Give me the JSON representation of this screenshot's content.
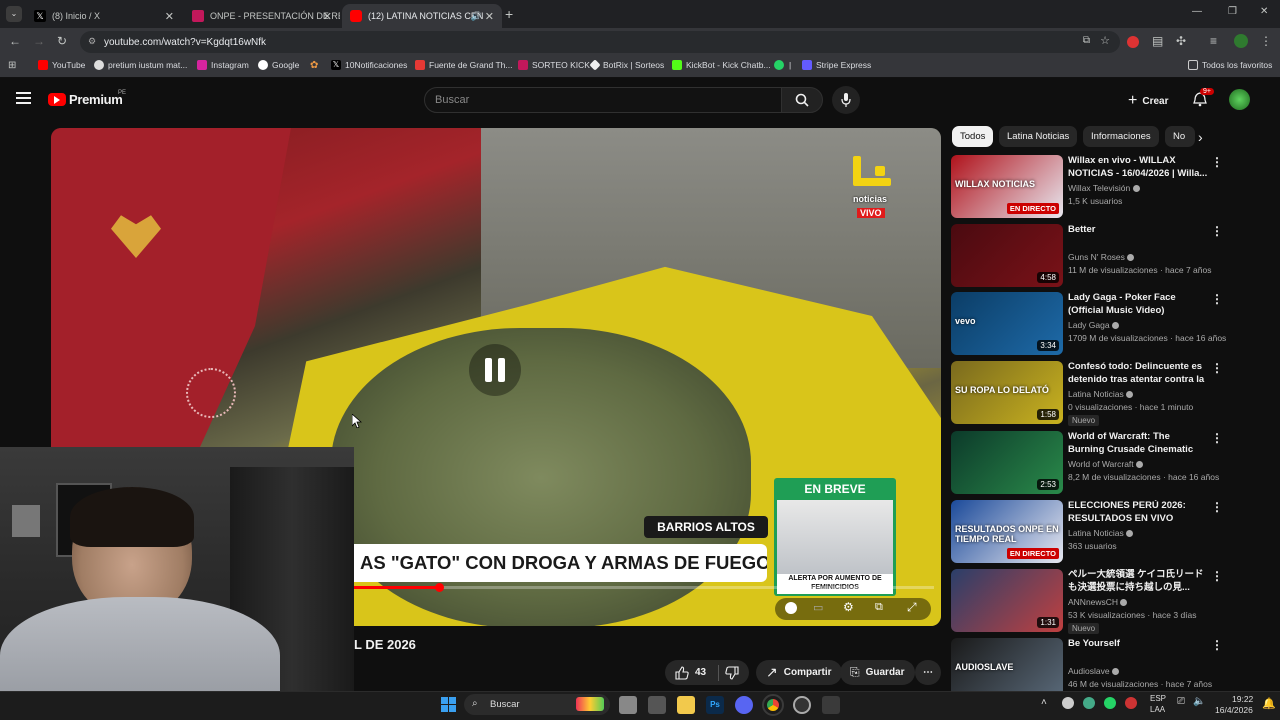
{
  "tabs": [
    {
      "title": "(8) Inicio / X",
      "color": "#000"
    },
    {
      "title": "ONPE - PRESENTACIÓN DE RES",
      "color": "#c2185b"
    },
    {
      "title": "(12) LATINA NOTICIAS CEN",
      "color": "#ff0000"
    }
  ],
  "url": "youtube.com/watch?v=Kgdqt16wNfk",
  "bookmarks": [
    "YouTube",
    "pretium iustum mat...",
    "Instagram",
    "Google",
    "10Notificaciones",
    "Fuente de Grand Th...",
    "SORTEO KICK",
    "BotRix | Sorteos",
    "KickBot - Kick Chatb...",
    "|",
    "Stripe Express",
    "Todos los favoritos"
  ],
  "yt": {
    "logo": "Premium",
    "logo_region": "PE",
    "search_placeholder": "Buscar",
    "create": "Crear",
    "notif_count": "9+"
  },
  "video": {
    "brand": "noticias",
    "live_label": "VIVO",
    "location": "BARRIOS ALTOS",
    "headline": "AS \"GATO\" CON DROGA Y ARMAS DE FUEGO",
    "brief_title": "EN BREVE",
    "brief_caption": "ALERTA POR AUMENTO DE FEMINICIDIOS",
    "title_fragment": "L DE 2026",
    "likes": "43",
    "share": "Compartir",
    "save": "Guardar"
  },
  "chips": [
    "Todos",
    "Latina Noticias",
    "Informaciones",
    "No"
  ],
  "recs": [
    {
      "title": "Willax en vivo - WILLAX NOTICIAS - 16/04/2026 | Willa...",
      "channel": "Willax Televisión",
      "meta": "1,5 K usuarios",
      "badge": "EN DIRECTO",
      "thumb_text": "WILLAX NOTICIAS",
      "c1": "#b0121b",
      "c2": "#e8e8f0"
    },
    {
      "title": "Better",
      "channel": "Guns N' Roses",
      "meta": "11 M de visualizaciones · hace 7 años",
      "badge": "4:58",
      "thumb_text": "",
      "c1": "#4a0a10",
      "c2": "#7a1218"
    },
    {
      "title": "Lady Gaga - Poker Face (Official Music Video)",
      "channel": "Lady Gaga",
      "meta": "1709 M de visualizaciones · hace 16 años",
      "badge": "3:34",
      "thumb_text": "vevo",
      "c1": "#0b3d66",
      "c2": "#1e6aa8"
    },
    {
      "title": "Confesó todo: Delincuente es detenido tras atentar contra la ...",
      "channel": "Latina Noticias",
      "meta": "0 visualizaciones · hace 1 minuto",
      "badge": "1:58",
      "thumb_text": "SU ROPA LO DELATÓ",
      "c1": "#7a6a1e",
      "c2": "#c9b21f",
      "nuevo": "Nuevo"
    },
    {
      "title": "World of Warcraft: The Burning Crusade Cinematic Trailer",
      "channel": "World of Warcraft",
      "meta": "8,2 M de visualizaciones · hace 16 años",
      "badge": "2:53",
      "thumb_text": "",
      "c1": "#0c3a2a",
      "c2": "#2a8a4a"
    },
    {
      "title": "ELECCIONES PERÚ 2026: RESULTADOS EN VIVO",
      "channel": "Latina Noticias",
      "meta": "363 usuarios",
      "badge": "EN DIRECTO",
      "thumb_text": "RESULTADOS ONPE EN TIEMPO REAL",
      "c1": "#1b4a9a",
      "c2": "#e8e8f0"
    },
    {
      "title": "ペルー大統領選 ケイコ氏リードも決選投票に持ち越しの見...",
      "channel": "ANNnewsCH",
      "meta": "53 K visualizaciones · hace 3 días",
      "badge": "1:31",
      "thumb_text": "",
      "c1": "#2a3f6a",
      "c2": "#c04040",
      "nuevo": "Nuevo"
    },
    {
      "title": "Be Yourself",
      "channel": "Audioslave",
      "meta": "46 M de visualizaciones · hace 7 años",
      "badge": "",
      "thumb_text": "AUDIOSLAVE",
      "c1": "#1a1a1a",
      "c2": "#5a6a7a"
    }
  ],
  "taskbar": {
    "search": "Buscar",
    "lang": "ESP",
    "kbd": "LAA",
    "time": "19:22",
    "date": "16/4/2026"
  }
}
